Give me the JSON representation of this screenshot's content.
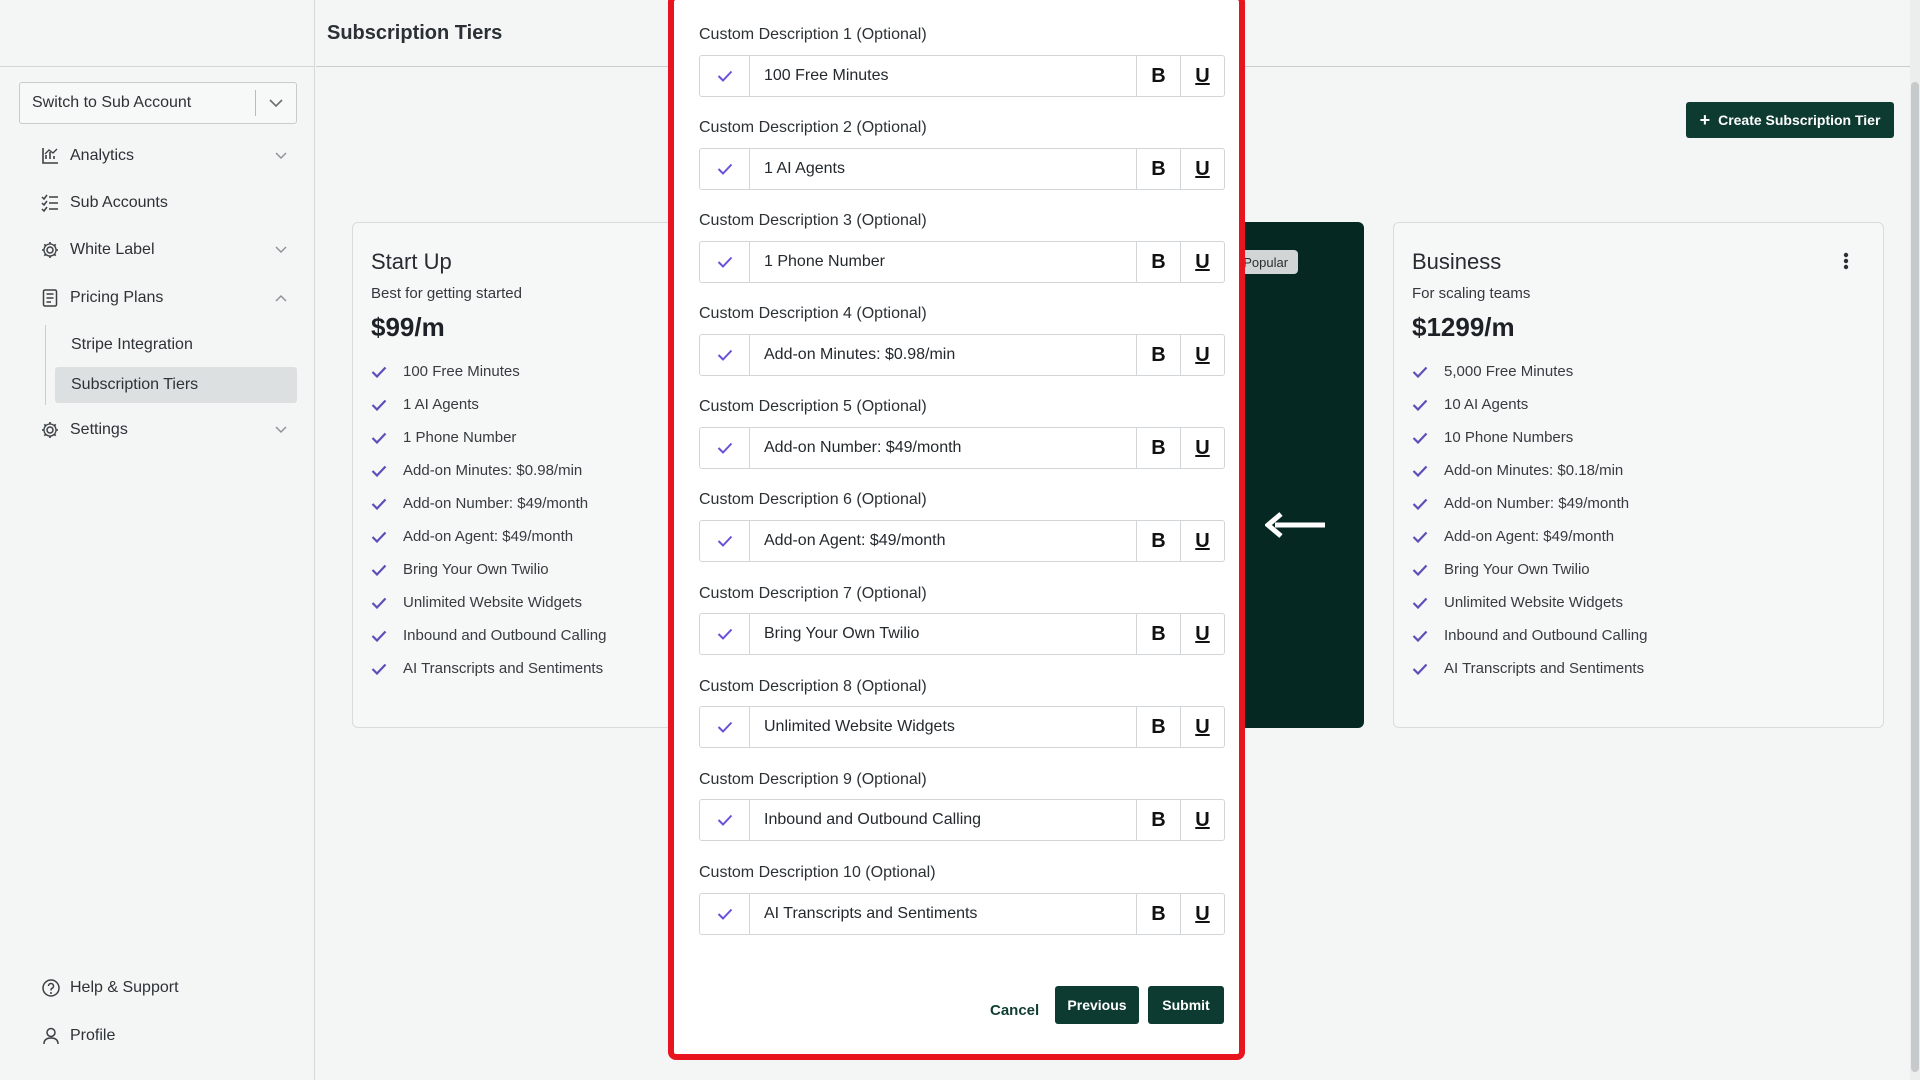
{
  "page": {
    "title": "Subscription Tiers",
    "create_button": "Create Subscription Tier"
  },
  "sidebar": {
    "switch_account": "Switch to Sub Account",
    "items": {
      "analytics": "Analytics",
      "sub_accounts": "Sub Accounts",
      "white_label": "White Label",
      "pricing_plans": "Pricing Plans",
      "stripe_integration": "Stripe Integration",
      "subscription_tiers": "Subscription Tiers",
      "settings": "Settings"
    },
    "bottom": {
      "help": "Help & Support",
      "profile": "Profile"
    }
  },
  "cards": {
    "startup": {
      "title": "Start Up",
      "subtitle": "Best for getting started",
      "price": "$99/m",
      "features": [
        "100 Free Minutes",
        "1 AI Agents",
        "1 Phone Number",
        "Add-on Minutes: $0.98/min",
        "Add-on Number: $49/month",
        "Add-on Agent: $49/month",
        "Bring Your Own Twilio",
        "Unlimited Website Widgets",
        "Inbound and Outbound Calling",
        "AI Transcripts and Sentiments"
      ]
    },
    "popular": {
      "badge": "t Popular"
    },
    "business": {
      "title": "Business",
      "subtitle": "For scaling teams",
      "price": "$1299/m",
      "features": [
        "5,000 Free Minutes",
        "10 AI Agents",
        "10 Phone Numbers",
        "Add-on Minutes: $0.18/min",
        "Add-on Number: $49/month",
        "Add-on Agent: $49/month",
        "Bring Your Own Twilio",
        "Unlimited Website Widgets",
        "Inbound and Outbound Calling",
        "AI Transcripts and Sentiments"
      ]
    }
  },
  "modal": {
    "fields": [
      {
        "label": "Custom Description 1 (Optional)",
        "value": "100 Free Minutes"
      },
      {
        "label": "Custom Description 2 (Optional)",
        "value": "1 AI Agents"
      },
      {
        "label": "Custom Description 3 (Optional)",
        "value": "1 Phone Number"
      },
      {
        "label": "Custom Description 4 (Optional)",
        "value": "Add-on Minutes: $0.98/min"
      },
      {
        "label": "Custom Description 5 (Optional)",
        "value": "Add-on Number: $49/month"
      },
      {
        "label": "Custom Description 6 (Optional)",
        "value": "Add-on Agent: $49/month"
      },
      {
        "label": "Custom Description 7 (Optional)",
        "value": "Bring Your Own Twilio"
      },
      {
        "label": "Custom Description 8 (Optional)",
        "value": "Unlimited Website Widgets"
      },
      {
        "label": "Custom Description 9 (Optional)",
        "value": "Inbound and Outbound Calling"
      },
      {
        "label": "Custom Description 10 (Optional)",
        "value": "AI Transcripts and Sentiments"
      }
    ],
    "bold_label": "B",
    "underline_label": "U",
    "cancel": "Cancel",
    "previous": "Previous",
    "submit": "Submit"
  },
  "colors": {
    "brand_dark_green": "#0e3b31",
    "check_purple": "#6b4fd8",
    "highlight_red": "#e8141e"
  },
  "icons": {
    "check": "check-icon",
    "bold": "bold-icon",
    "underline": "underline-icon",
    "arrow": "arrow-left-icon",
    "kebab": "kebab-menu-icon"
  }
}
